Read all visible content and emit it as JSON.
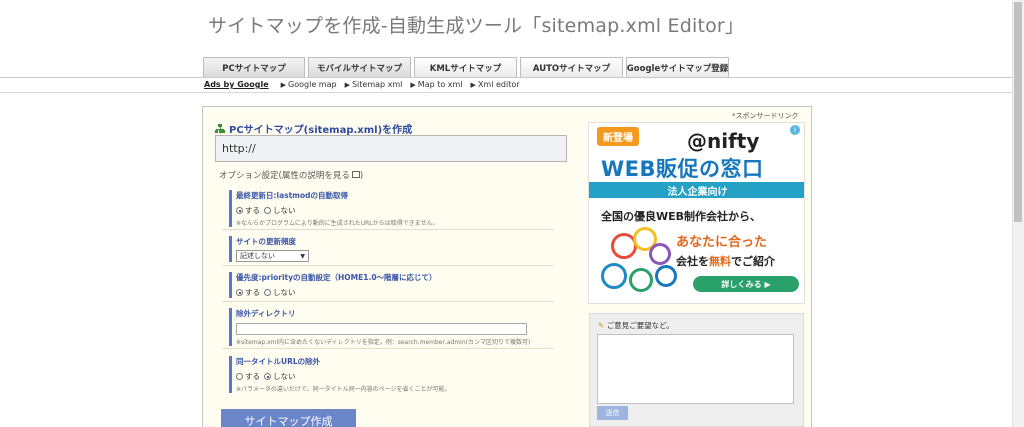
{
  "header": {
    "title": "サイトマップを作成-自動生成ツール「sitemap.xml Editor」"
  },
  "tabs": [
    {
      "label": "PCサイトマップ"
    },
    {
      "label": "モバイルサイトマップ"
    },
    {
      "label": "KMLサイトマップ"
    },
    {
      "label": "AUTOサイトマップ"
    },
    {
      "label": "Googleサイトマップ登録"
    }
  ],
  "subnav": {
    "ads_label": "Ads by Google",
    "links": [
      "Google map",
      "Sitemap xml",
      "Map to xml",
      "Xml editor"
    ]
  },
  "main": {
    "heading": "PCサイトマップ(sitemap.xml)を作成",
    "url_value": "http://",
    "options_heading": "オプション設定(属性の説明を見る",
    "lastmod": {
      "label": "最終更新日:lastmodの自動取得",
      "yes": "する",
      "no": "しない",
      "note": "※なんらかプログラムにより動的に生成されたURLからは取得できません。"
    },
    "changefreq": {
      "label": "サイトの更新頻度",
      "selected": "記述しない"
    },
    "priority": {
      "label": "優先度:priorityの自動設定（HOME1.0～階層に応じて）",
      "yes": "する",
      "no": "しない"
    },
    "exclude": {
      "label": "除外ディレクトリ",
      "note": "※sitemap.xml内に含めたくないディレクトリを指定。例：search,member,admin(カンマ区切りで複数可)"
    },
    "dedupe": {
      "label": "同一タイトルURLの除外",
      "yes": "する",
      "no": "しない",
      "note": "※パラメータの違いだけで、同一タイトル同一内容のページを省くことが可能。"
    },
    "submit_label": "サイトマップ作成"
  },
  "sidebar": {
    "sponsor_label": "*スポンサードリンク",
    "ad": {
      "badge": "新登場",
      "brand": "@nifty",
      "headline": "WEB販促の窓口",
      "band": "法人企業向け",
      "line1": "全国の優良WEB制作会社から、",
      "line2": "あなたに合った",
      "line3_a": "会社を",
      "line3_b": "無料",
      "line3_c": "でご紹介",
      "cta": "詳しくみる ▶"
    },
    "feedback": {
      "label": "ご意見ご要望など。",
      "send_label": "送信"
    }
  },
  "colors": {
    "link_blue": "#2e4a9e",
    "option_bar": "#5a78c8",
    "submit": "#6b85c9",
    "ad_blue": "#1777bd",
    "ad_band": "#26a1c6"
  }
}
